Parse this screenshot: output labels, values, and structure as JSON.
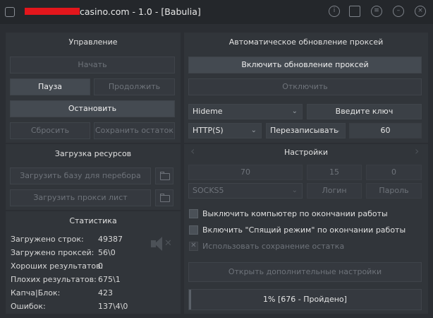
{
  "window": {
    "title": "casino.com - 1.0 - [Babulia]"
  },
  "left": {
    "control_title": "Управление",
    "start": "Начать",
    "pause": "Пауза",
    "resume": "Продолжить",
    "stop": "Остановить",
    "reset": "Сбросить",
    "save_rest": "Сохранить остаток",
    "resources_title": "Загрузка ресурсов",
    "load_base": "Загрузить базу для перебора",
    "load_proxy": "Загрузить прокси лист",
    "stats_title": "Статистика",
    "stats": [
      {
        "label": "Загружено строк:",
        "value": "49387"
      },
      {
        "label": "Загружено проксей:",
        "value": "56\\0"
      },
      {
        "label": "Хороших результатов:",
        "value": "0"
      },
      {
        "label": "Плохих результатов:",
        "value": "675\\1"
      },
      {
        "label": "Капча|Блок:",
        "value": "423"
      },
      {
        "label": "Ошибок:",
        "value": "137\\4\\0"
      }
    ]
  },
  "right": {
    "proxy_title": "Автоматическое обновление проксей",
    "enable_proxy": "Включить обновление проксей",
    "disable": "Отключить",
    "proxy_source": "Hideme",
    "enter_key": "Введите ключ",
    "protocol": "HTTP(S)",
    "mode": "Перезаписывать",
    "interval": "60",
    "settings_title": "Настройки",
    "threads": "70",
    "timeout": "15",
    "retries": "0",
    "proxy_type": "SOCKS5",
    "login": "Логин",
    "password": "Пароль",
    "cb_shutdown": "Выключить компьютер по окончании работы",
    "cb_sleep": "Включить \"Спящий режим\" по окончании работы",
    "cb_use_rest": "Использовать сохранение остатка",
    "open_more": "Открыть дополнительные настройки",
    "progress_text": "1% [676 - Пройдено]",
    "progress_fraction": 0.01
  }
}
